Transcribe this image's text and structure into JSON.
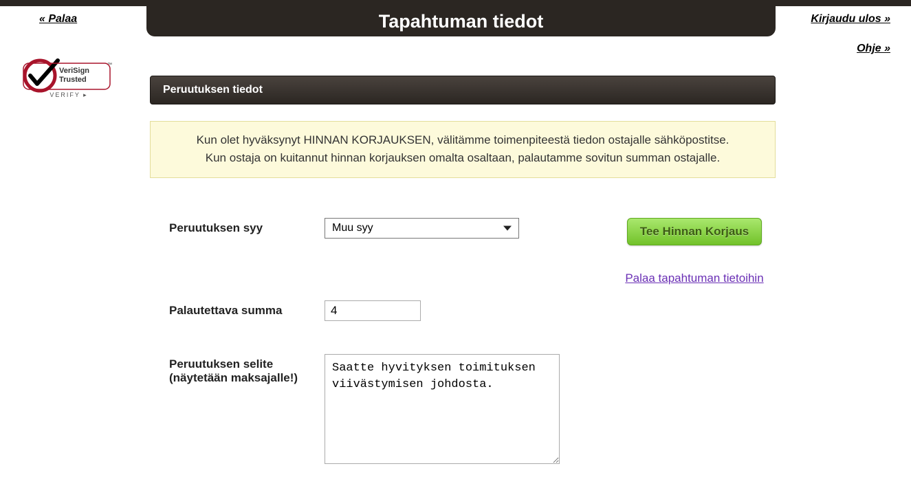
{
  "header": {
    "back_label": "« Palaa",
    "title": "Tapahtuman tiedot",
    "logout_label": "Kirjaudu ulos »",
    "help_label": "Ohje »"
  },
  "verisign": {
    "line1": "VeriSign",
    "line2": "Trusted",
    "verify": "VERIFY ▸"
  },
  "section": {
    "title": "Peruutuksen tiedot"
  },
  "info_box": {
    "line1": "Kun olet hyväksynyt HINNAN KORJAUKSEN, välitämme toimenpiteestä tiedon ostajalle sähköpostitse.",
    "line2": "Kun ostaja on kuitannut hinnan korjauksen omalta osaltaan, palautamme sovitun summan ostajalle."
  },
  "form": {
    "reason_label": "Peruutuksen syy",
    "reason_value": "Muu syy",
    "amount_label": "Palautettava summa",
    "amount_value": "4",
    "desc_label_line1": "Peruutuksen selite",
    "desc_label_line2": "(näytetään maksajalle!)",
    "desc_value": "Saatte hyvityksen toimituksen viivästymisen johdosta."
  },
  "actions": {
    "submit_label": "Tee Hinnan Korjaus",
    "return_label": "Palaa tapahtuman tietoihin"
  }
}
